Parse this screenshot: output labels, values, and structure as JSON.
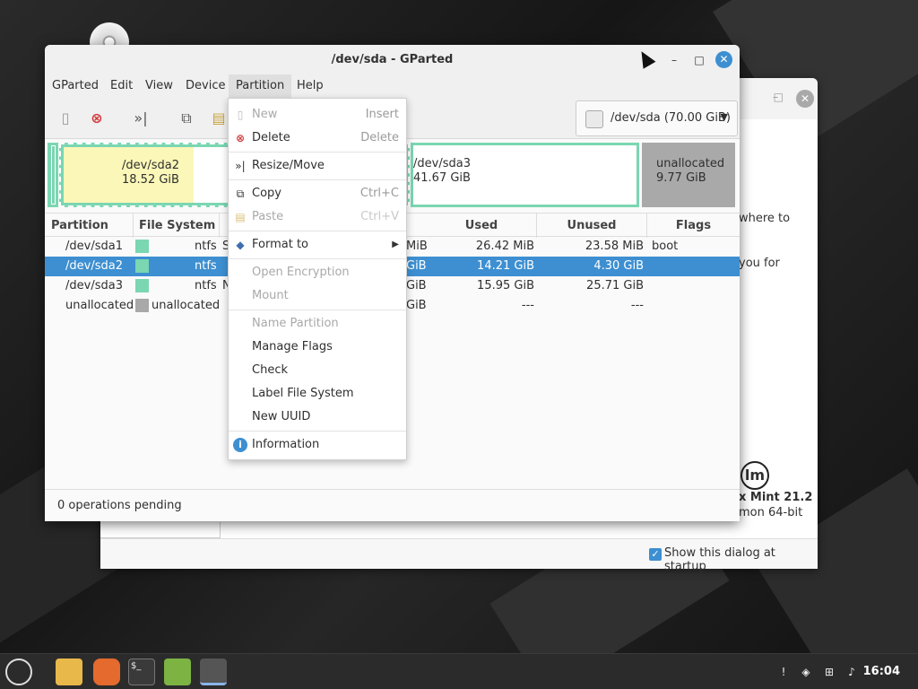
{
  "welcome": {
    "text_line1": "where to",
    "text_line2": "you for",
    "version": "x Mint 21.2",
    "arch": "mon 64-bit",
    "logo": "lm",
    "startup_checkbox_label": "Show this dialog at startup"
  },
  "window": {
    "title": "/dev/sda - GParted",
    "minimize": "–",
    "maximize": "□",
    "close": "✕"
  },
  "menubar": [
    "GParted",
    "Edit",
    "View",
    "Device",
    "Partition",
    "Help"
  ],
  "device_selector": {
    "label": "/dev/sda (70.00 GiB)",
    "arrow": "▼"
  },
  "disk_map": [
    {
      "name": "/dev/sda2",
      "size": "18.52 GiB"
    },
    {
      "name": "/dev/sda3",
      "size": "41.67 GiB"
    },
    {
      "name": "unallocated",
      "size": "9.77 GiB"
    }
  ],
  "table": {
    "headers": [
      "Partition",
      "File System",
      "Used",
      "Unused",
      "Flags"
    ],
    "rows": [
      {
        "partition": "/dev/sda1",
        "fs": "ntfs",
        "mid": "S",
        "size_tail": "MiB",
        "used": "26.42 MiB",
        "unused": "23.58 MiB",
        "flags": "boot",
        "color": "#7bd6b2"
      },
      {
        "partition": "/dev/sda2",
        "fs": "ntfs",
        "mid": "",
        "size_tail": "GiB",
        "used": "14.21 GiB",
        "unused": "4.30 GiB",
        "flags": "",
        "color": "#7bd6b2"
      },
      {
        "partition": "/dev/sda3",
        "fs": "ntfs",
        "mid": "N",
        "size_tail": "GiB",
        "used": "15.95 GiB",
        "unused": "25.71 GiB",
        "flags": "",
        "color": "#7bd6b2"
      },
      {
        "partition": "unallocated",
        "fs": "unallocated",
        "mid": "",
        "size_tail": "GiB",
        "used": "---",
        "unused": "---",
        "flags": "",
        "color": "#a9a9a9"
      }
    ]
  },
  "status": "0 operations pending",
  "partition_menu": [
    {
      "label": "New",
      "accel": "Insert",
      "disabled": true,
      "icon": "new-icon"
    },
    {
      "label": "Delete",
      "accel": "Delete",
      "disabled": false,
      "icon": "delete-icon"
    },
    {
      "label": "Resize/Move",
      "accel": "",
      "disabled": false,
      "icon": "resize-icon"
    },
    {
      "label": "Copy",
      "accel": "Ctrl+C",
      "disabled": false,
      "icon": "copy-icon"
    },
    {
      "label": "Paste",
      "accel": "Ctrl+V",
      "disabled": true,
      "icon": "paste-icon"
    },
    {
      "label": "Format to",
      "accel": "",
      "disabled": false,
      "icon": "format-icon"
    },
    {
      "label": "Open Encryption",
      "accel": "",
      "disabled": true,
      "icon": ""
    },
    {
      "label": "Mount",
      "accel": "",
      "disabled": true,
      "icon": ""
    },
    {
      "label": "Name Partition",
      "accel": "",
      "disabled": true,
      "icon": ""
    },
    {
      "label": "Manage Flags",
      "accel": "",
      "disabled": false,
      "icon": ""
    },
    {
      "label": "Check",
      "accel": "",
      "disabled": false,
      "icon": ""
    },
    {
      "label": "Label File System",
      "accel": "",
      "disabled": false,
      "icon": ""
    },
    {
      "label": "New UUID",
      "accel": "",
      "disabled": false,
      "icon": ""
    },
    {
      "label": "Information",
      "accel": "",
      "disabled": false,
      "icon": "info-icon"
    }
  ],
  "taskbar": {
    "clock": "16:04",
    "terminal_glyph": "$_"
  },
  "colors": {
    "accent": "#3d8fd1",
    "partition_ntfs": "#7bd6b2",
    "unallocated": "#a9a9a9",
    "sda2_fill": "#fbf7b8"
  }
}
